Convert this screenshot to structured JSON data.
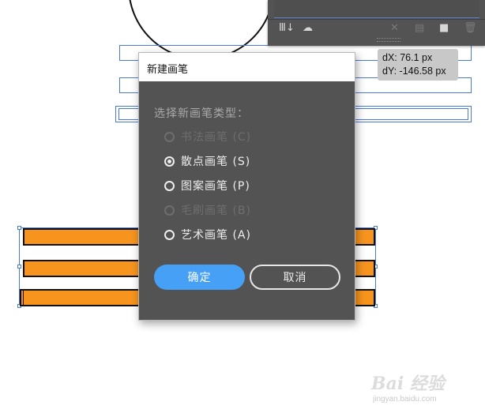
{
  "dialog": {
    "title": "新建画笔",
    "prompt": "选择新画笔类型：",
    "options": [
      {
        "label": "书法画笔 (C)",
        "enabled": false,
        "selected": false
      },
      {
        "label": "散点画笔 (S)",
        "enabled": true,
        "selected": true
      },
      {
        "label": "图案画笔 (P)",
        "enabled": true,
        "selected": false
      },
      {
        "label": "毛刷画笔 (B)",
        "enabled": false,
        "selected": false
      },
      {
        "label": "艺术画笔 (A)",
        "enabled": true,
        "selected": false
      }
    ],
    "ok_label": "确定",
    "cancel_label": "取消"
  },
  "tooltip": {
    "dx": "dX: 76.1 px",
    "dy": "dY: -146.58 px"
  },
  "panel": {
    "buttons": [
      "brush-libraries-icon",
      "libraries-icon",
      "remove-stroke-icon",
      "options-icon",
      "new-brush-icon",
      "delete-brush-icon"
    ]
  },
  "watermark": {
    "brand": "Bai 经验",
    "url": "jingyan.baidu.com"
  },
  "colors": {
    "stroke_fill": "#f7941e",
    "dialog_bg": "#535353",
    "ok_button": "#46a0f5",
    "selection_guide": "#4a78d8"
  }
}
